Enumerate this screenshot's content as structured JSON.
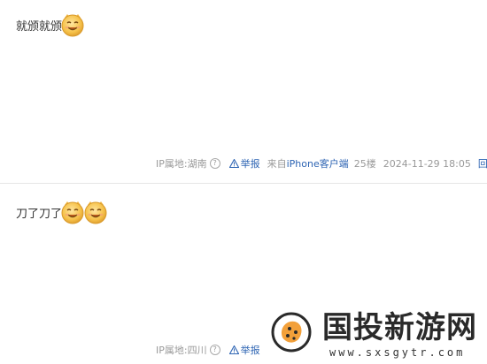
{
  "posts": [
    {
      "content": "就颁就颁",
      "emoji_count": 1,
      "meta": {
        "ip_location": "IP属地:湖南",
        "help": "?",
        "report": "举报",
        "from_prefix": "来自",
        "client": "iPhone客户端",
        "floor": "25楼",
        "time": "2024-11-29 18:05",
        "reply": "回复"
      }
    },
    {
      "content": "刀了刀了",
      "emoji_count": 2,
      "meta": {
        "ip_location": "IP属地:四川",
        "help": "?",
        "report": "举报"
      }
    }
  ],
  "watermark": {
    "title": "国投新游网",
    "url": "www.sxsgytr.com"
  },
  "colors": {
    "link": "#2d64b3",
    "meta_text": "#999999",
    "divider": "#e6e6e6",
    "emoji_face": "#f6c24a"
  },
  "icons": {
    "emoji": "smiley-face-icon",
    "report": "warning-triangle-icon",
    "help": "question-circle-icon",
    "logo": "cookie-logo-icon"
  }
}
